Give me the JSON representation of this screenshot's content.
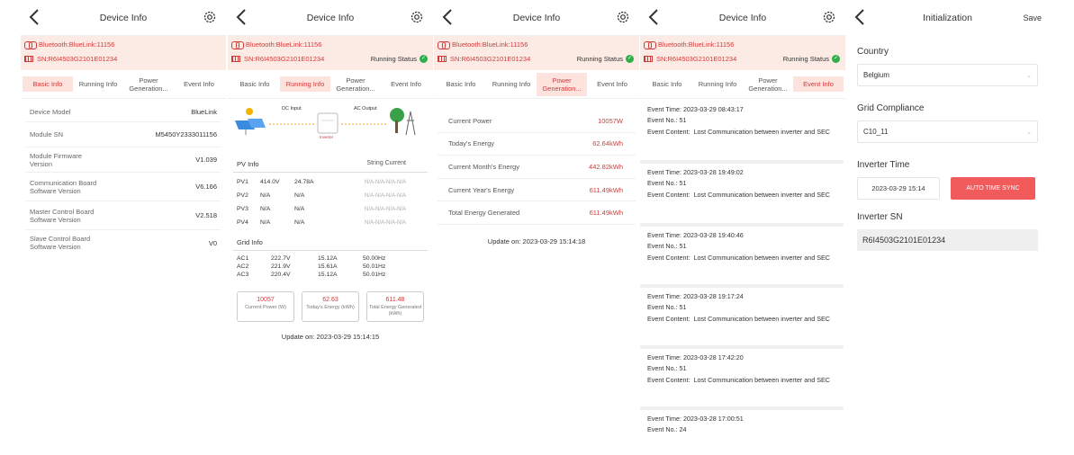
{
  "common": {
    "title": "Device Info",
    "bluetooth": "Bluetooth:BlueLink:11156",
    "sn": "SN:R6I4503G2101E01234",
    "running_status": "Running Status",
    "tabs": [
      "Basic Info",
      "Running Info",
      "Power Generation...",
      "Event Info"
    ]
  },
  "basic_info": {
    "rows": [
      {
        "label": "Device Model",
        "value": "BlueLink"
      },
      {
        "label": "Module SN",
        "value": "M5450Y2333011156"
      },
      {
        "label": "Module Firmware Version",
        "value": "V1.039"
      },
      {
        "label": "Communication Board Software Version",
        "value": "V6.166"
      },
      {
        "label": "Master Control Board Software Version",
        "value": "V2.518"
      },
      {
        "label": "Slave Control Board Software Version",
        "value": "V0"
      }
    ]
  },
  "running_info": {
    "diagram": {
      "dc_input": "DC Input",
      "ac_output": "AC Output",
      "inverter": "Inverter"
    },
    "pv_title": "PV Info",
    "string_current": "String Current",
    "pv_rows": [
      {
        "name": "PV1",
        "v": "414.0V",
        "a": "24.78A",
        "s": "N/A-N/A-N/A-N/A"
      },
      {
        "name": "PV2",
        "v": "N/A",
        "a": "N/A",
        "s": "N/A-N/A-N/A-N/A"
      },
      {
        "name": "PV3",
        "v": "N/A",
        "a": "N/A",
        "s": "N/A-N/A-N/A-N/A"
      },
      {
        "name": "PV4",
        "v": "N/A",
        "a": "N/A",
        "s": "N/A-N/A-N/A-N/A"
      }
    ],
    "grid_title": "Grid Info",
    "grid_rows": [
      {
        "name": "AC1",
        "v": "222.7V",
        "a": "15.12A",
        "f": "50.00Hz"
      },
      {
        "name": "AC2",
        "v": "221.9V",
        "a": "15.61A",
        "f": "50.01Hz"
      },
      {
        "name": "AC3",
        "v": "220.4V",
        "a": "15.12A",
        "f": "50.01Hz"
      }
    ],
    "boxes": [
      {
        "value": "10057",
        "label": "Current Power (W)"
      },
      {
        "value": "62.63",
        "label": "Today's Energy (kWh)"
      },
      {
        "value": "611.48",
        "label": "Total Energy Generated (kWh)"
      }
    ],
    "update": "Update on: 2023-03-29 15:14:15"
  },
  "power_generation": {
    "rows": [
      {
        "label": "Current Power",
        "value": "10057W"
      },
      {
        "label": "Today's Energy",
        "value": "62.64kWh"
      },
      {
        "label": "Current Month's Energy",
        "value": "442.82kWh"
      },
      {
        "label": "Current Year's Energy",
        "value": "611.49kWh"
      },
      {
        "label": "Total Energy Generated",
        "value": "611.49kWh"
      }
    ],
    "update": "Update on: 2023-03-29 15:14:18"
  },
  "event_info": {
    "events": [
      {
        "time": "Event Time:  2023-03-29 08:43:17",
        "no": "Event No.:  51",
        "content_label": "Event Content:",
        "content": "Lost Communication between inverter and SEC"
      },
      {
        "time": "Event Time:  2023-03-28 19:49:02",
        "no": "Event No.:  51",
        "content_label": "Event Content:",
        "content": "Lost Communication between inverter and SEC"
      },
      {
        "time": "Event Time:  2023-03-28 19:40:46",
        "no": "Event No.:  51",
        "content_label": "Event Content:",
        "content": "Lost Communication between inverter and SEC"
      },
      {
        "time": "Event Time:  2023-03-28 19:17:24",
        "no": "Event No.:  51",
        "content_label": "Event Content:",
        "content": "Lost Communication between inverter and SEC"
      },
      {
        "time": "Event Time:  2023-03-28 17:42:20",
        "no": "Event No.:  51",
        "content_label": "Event Content:",
        "content": "Lost Communication between inverter and SEC"
      },
      {
        "time": "Event Time:  2023-03-28 17:00:51",
        "no": "Event No.:  24",
        "content_label": "",
        "content": ""
      }
    ]
  },
  "initialization": {
    "title": "Initialization",
    "save": "Save",
    "country_label": "Country",
    "country_value": "Belgium",
    "grid_label": "Grid Compliance",
    "grid_value": "C10_11",
    "time_label": "Inverter Time",
    "time_value": "2023-03-29 15:14",
    "sync_button": "AUTO TIME SYNC",
    "sn_label": "Inverter SN",
    "sn_value": "R6I4503G2101E01234"
  },
  "colors": {
    "accent": "#d23a3a",
    "accent_bg": "#fcebe4",
    "sync_button": "#f15b5b"
  }
}
